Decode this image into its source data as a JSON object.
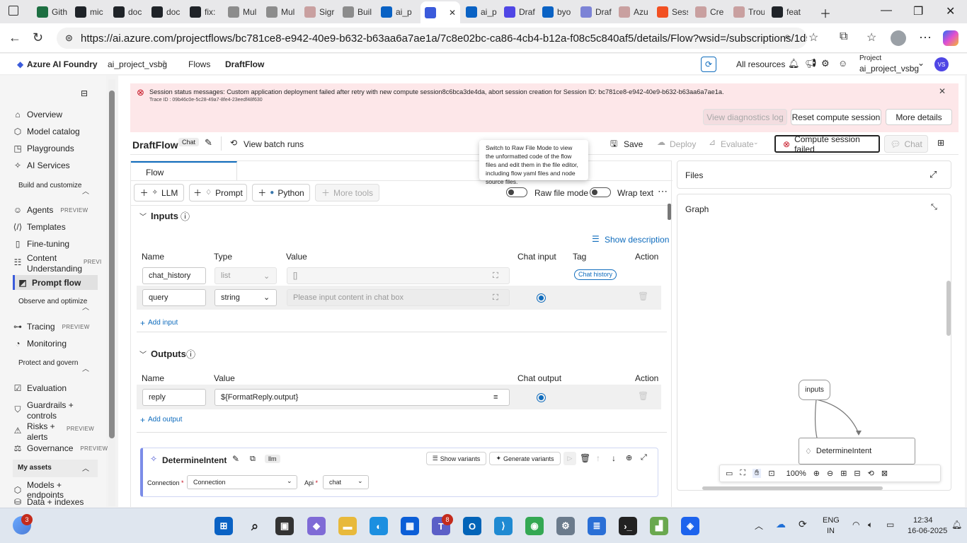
{
  "browser": {
    "tabs": [
      {
        "label": "Gith",
        "icon": "excel-icon",
        "color": "#1d6f42"
      },
      {
        "label": "mic",
        "icon": "github-icon",
        "color": "#1f2328"
      },
      {
        "label": "doc",
        "icon": "github-icon",
        "color": "#1f2328"
      },
      {
        "label": "doc",
        "icon": "github-icon",
        "color": "#1f2328"
      },
      {
        "label": "fix:",
        "icon": "github-icon",
        "color": "#1f2328"
      },
      {
        "label": "Mul",
        "icon": "github-icon",
        "color": "#8c8c8c"
      },
      {
        "label": "Mul",
        "icon": "github-icon",
        "color": "#8c8c8c"
      },
      {
        "label": "Sigr",
        "icon": "page-icon",
        "color": "#c9a0a0"
      },
      {
        "label": "Buil",
        "icon": "github-icon",
        "color": "#8c8c8c"
      },
      {
        "label": "ai_p",
        "icon": "azure-icon",
        "color": "#0a62c4"
      },
      {
        "label": "",
        "icon": "foundry-icon",
        "color": "#3b5bdb"
      },
      {
        "label": "ai_p",
        "icon": "azure-icon",
        "color": "#0a62c4"
      },
      {
        "label": "Draf",
        "icon": "foundry-icon",
        "color": "#4f46e5"
      },
      {
        "label": "byo",
        "icon": "azure-icon",
        "color": "#0a62c4"
      },
      {
        "label": "Draf",
        "icon": "foundry-icon",
        "color": "#7c83d6"
      },
      {
        "label": "Azu",
        "icon": "page-icon",
        "color": "#c9a0a0"
      },
      {
        "label": "Sess",
        "icon": "microsoft-icon",
        "color": "#f25022"
      },
      {
        "label": "Cre",
        "icon": "page-icon",
        "color": "#c9a0a0"
      },
      {
        "label": "Trou",
        "icon": "page-icon",
        "color": "#c9a0a0"
      },
      {
        "label": "feat",
        "icon": "github-icon",
        "color": "#1f2328"
      }
    ],
    "url": "https://ai.azure.com/projectflows/bc781ce8-e942-40e9-b632-b63aa6a7ae1a/7c8e02bc-ca86-4cb4-b12a-f08c5c840af5/details/Flow?wsid=/subscriptions/1d58..."
  },
  "header": {
    "brand": "Azure AI Foundry",
    "crumbs": [
      "ai_project_vsbg",
      "Flows",
      "DraftFlow"
    ],
    "all_resources": "All resources",
    "project_label": "Project",
    "project_name": "ai_project_vsbg",
    "avatar": "VS"
  },
  "sidebar": {
    "items_top": [
      "Overview",
      "Model catalog",
      "Playgrounds",
      "AI Services"
    ],
    "section_build": "Build and customize",
    "build_items": [
      "Agents",
      "Templates",
      "Fine-tuning",
      "Content Understanding",
      "Prompt flow"
    ],
    "preview": "PREVIEW",
    "preview_cut": "PREVI",
    "section_observe": "Observe and optimize",
    "observe_items": [
      "Tracing",
      "Monitoring"
    ],
    "section_protect": "Protect and govern",
    "protect_items": [
      "Evaluation",
      "Guardrails + controls",
      "Risks + alerts",
      "Governance"
    ],
    "section_assets": "My assets",
    "asset_items": [
      "Models + endpoints",
      "Data + indexes"
    ]
  },
  "banner": {
    "message": "Session status messages: Custom application deployment failed after retry with new compute session8c6bca3de4da, abort session creation for Session ID: bc781ce8-e942-40e9-b632-b63aa6a7ae1a.",
    "trace": "Trace ID : 09b46c0e-5c28-49a7-8fe4-23eedf48f630",
    "btn_diag": "View diagnostics log",
    "btn_reset": "Reset compute session",
    "btn_more": "More details"
  },
  "toolbar": {
    "title": "DraftFlow",
    "badge": "Chat",
    "batch": "View batch runs",
    "save": "Save",
    "deploy": "Deploy",
    "evaluate": "Evaluate",
    "compute": "Compute session failed",
    "chat": "Chat"
  },
  "tooltip": "Switch to Raw File Mode to view the unformatted code of the flow files and edit them in the file editor, including flow yaml files and node source files.",
  "flow": {
    "tab": "Flow",
    "add_llm": "LLM",
    "add_prompt": "Prompt",
    "add_python": "Python",
    "more_tools": "More tools",
    "raw_file_mode": "Raw file mode",
    "wrap_text": "Wrap text",
    "inputs_title": "Inputs",
    "show_description": "Show description",
    "input_headers": {
      "name": "Name",
      "type": "Type",
      "value": "Value",
      "chat_input": "Chat input",
      "tag": "Tag",
      "action": "Action"
    },
    "inputs": [
      {
        "name": "chat_history",
        "type": "list",
        "value": "[]",
        "tag": "Chat history"
      },
      {
        "name": "query",
        "type": "string",
        "placeholder": "Please input content in chat box"
      }
    ],
    "add_input": "Add input",
    "outputs_title": "Outputs",
    "output_headers": {
      "name": "Name",
      "value": "Value",
      "chat_output": "Chat output",
      "action": "Action"
    },
    "outputs": [
      {
        "name": "reply",
        "value": "${FormatReply.output}"
      }
    ],
    "add_output": "Add output",
    "node": {
      "name": "DetermineIntent",
      "type": "llm",
      "show_variants": "Show variants",
      "generate_variants": "Generate variants",
      "connection_label": "Connection",
      "connection_value": "Connection",
      "api_label": "Api",
      "api_value": "chat"
    }
  },
  "right": {
    "files": "Files",
    "graph": "Graph",
    "graph_nodes": [
      "inputs",
      "DetermineIntent"
    ],
    "zoom": "100%"
  },
  "taskbar": {
    "badge_left": "3",
    "badge_teams": "8",
    "lang1": "ENG",
    "lang2": "IN",
    "time": "12:34",
    "date": "16-06-2025"
  }
}
